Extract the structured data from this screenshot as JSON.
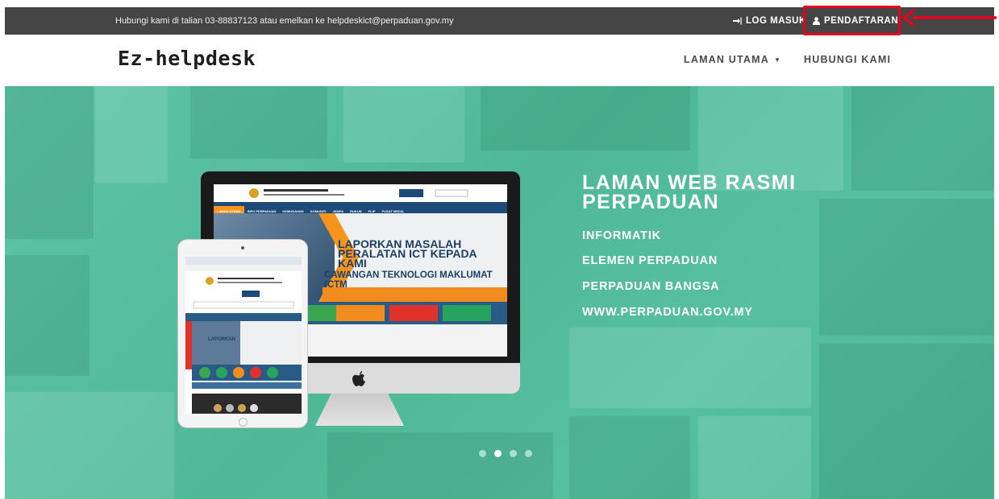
{
  "topbar": {
    "contact_text": "Hubungi kami di talian 03-88837123 atau emelkan ke helpdeskict@perpaduan.gov.my",
    "login_label": "LOG MASUK",
    "register_label": "PENDAFTARAN",
    "login_icon": "sign-in-icon",
    "register_icon": "user-icon"
  },
  "navbar": {
    "logo": "Ez-helpdesk",
    "items": [
      {
        "label": "LAMAN UTAMA",
        "has_dropdown": true
      },
      {
        "label": "HUBUNGI KAMI",
        "has_dropdown": false
      }
    ]
  },
  "hero": {
    "title_line1": "LAMAN WEB RASMI",
    "title_line2": "PERPADUAN",
    "links": [
      "INFORMATIK",
      "ELEMEN PERPADUAN",
      "PERPADUAN BANGSA",
      "WWW.PERPADUAN.GOV.MY"
    ],
    "slides": 4,
    "active_slide": 1,
    "screen_headline": "LAPORKAN MASALAH PERALATAN ICT KEPADA KAMI",
    "screen_subline": "CAWANGAN TEKNOLOGI MAKLUMAT (CTM"
  },
  "colors": {
    "topbar_bg": "#454545",
    "hero_bg": "#57c0a0",
    "highlight": "#e8001c"
  }
}
